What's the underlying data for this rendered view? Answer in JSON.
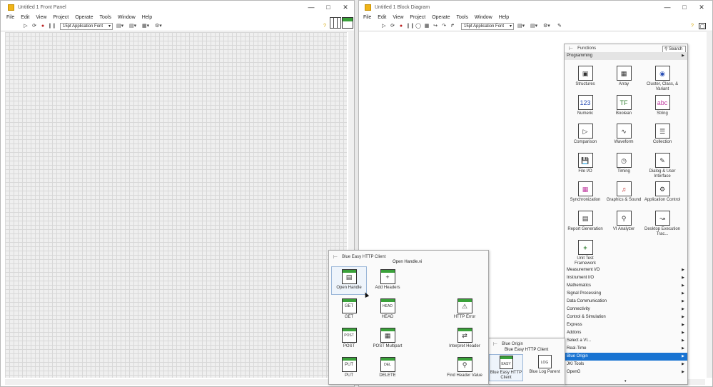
{
  "front_panel": {
    "title": "Untitled 1 Front Panel",
    "menu": [
      "File",
      "Edit",
      "View",
      "Project",
      "Operate",
      "Tools",
      "Window",
      "Help"
    ],
    "font": "15pt Application Font"
  },
  "block_diagram": {
    "title": "Untitled 1 Block Diagram",
    "menu": [
      "File",
      "Edit",
      "View",
      "Project",
      "Operate",
      "Tools",
      "Window",
      "Help"
    ],
    "font": "15pt Application Font"
  },
  "functions": {
    "title": "Functions",
    "search": "Search",
    "category": "Programming",
    "items": [
      "Structures",
      "Array",
      "Cluster, Class, & Variant",
      "Numeric",
      "Boolean",
      "String",
      "Comparison",
      "Waveform",
      "Collection",
      "File I/O",
      "Timing",
      "Dialog & User Interface",
      "Synchronization",
      "Graphics & Sound",
      "Application Control",
      "Report Generation",
      "VI Analyzer",
      "Desktop Execution Trac...",
      "Unit Test Framework"
    ],
    "categories": [
      "Measurement I/O",
      "Instrument I/O",
      "Mathematics",
      "Signal Processing",
      "Data Communication",
      "Connectivity",
      "Control & Simulation",
      "Express",
      "Addons",
      "Select a VI...",
      "Real-Time",
      "Blue Origin",
      "JKI Tools",
      "OpenG"
    ],
    "selected_category": "Blue Origin"
  },
  "blue_origin": {
    "title": "Blue Origin",
    "tooltip": "Blue Easy HTTP Client",
    "items": [
      "Blue Easy HTTP Client",
      "Blue Log Parent"
    ]
  },
  "http": {
    "title": "Blue Easy HTTP Client",
    "tooltip": "Open Handle.vi",
    "items": [
      "Open Handle",
      "Add Headers",
      "GET",
      "HEAD",
      "HTTP Error",
      "POST",
      "POST Multipart",
      "Interpret Header",
      "PUT",
      "DELETE",
      "Find Header Value"
    ]
  },
  "icons": {
    "window": [
      "minimize-icon",
      "maximize-icon",
      "close-icon"
    ],
    "run": [
      "run-arrow-icon",
      "run-continuous-icon",
      "abort-icon",
      "pause-icon"
    ],
    "help": "help-icon",
    "pin": "pin-icon",
    "search": "search-icon"
  },
  "colors": {
    "selection": "#1873d2",
    "vi_banner": "#3aa13a",
    "app_icon": "#f0b419"
  }
}
